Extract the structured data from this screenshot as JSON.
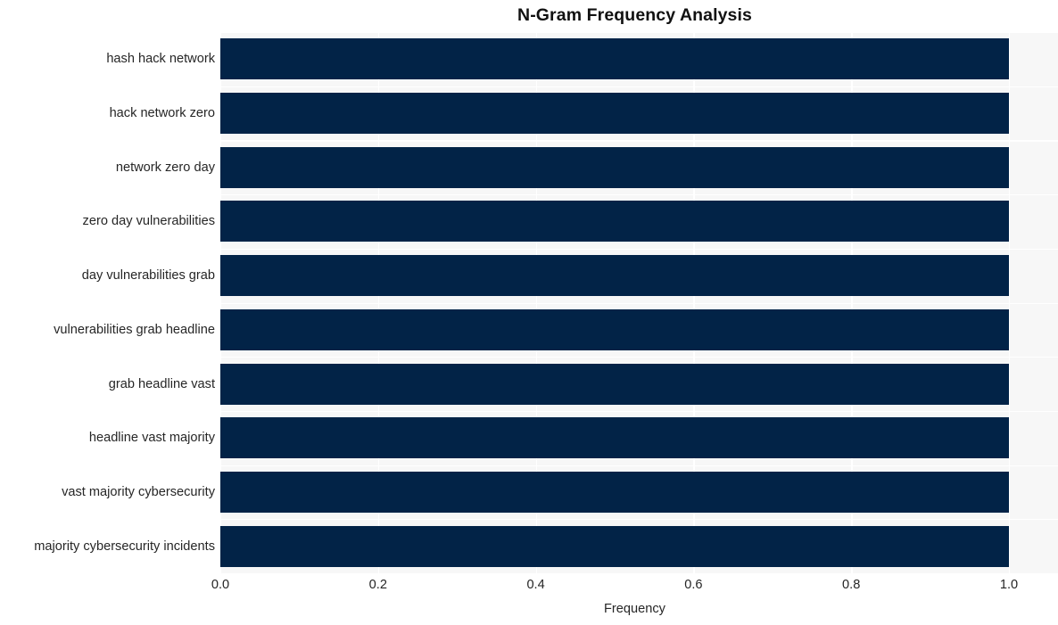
{
  "chart_data": {
    "type": "bar",
    "orientation": "horizontal",
    "title": "N-Gram Frequency Analysis",
    "xlabel": "Frequency",
    "ylabel": "",
    "categories": [
      "hash hack network",
      "hack network zero",
      "network zero day",
      "zero day vulnerabilities",
      "day vulnerabilities grab",
      "vulnerabilities grab headline",
      "grab headline vast",
      "headline vast majority",
      "vast majority cybersecurity",
      "majority cybersecurity incidents"
    ],
    "values": [
      1.0,
      1.0,
      1.0,
      1.0,
      1.0,
      1.0,
      1.0,
      1.0,
      1.0,
      1.0
    ],
    "xlim": [
      0.0,
      1.0
    ],
    "xticks": [
      "0.0",
      "0.2",
      "0.4",
      "0.6",
      "0.8",
      "1.0"
    ],
    "xtick_values": [
      0.0,
      0.2,
      0.4,
      0.6,
      0.8,
      1.0
    ],
    "grid": true,
    "legend": false,
    "colors": {
      "bar": "#022347",
      "panel_background": "#f7f7f7",
      "gridline": "#ffffff",
      "figure_background": "#ffffff",
      "text": "#262626",
      "title_text": "#111111"
    }
  }
}
